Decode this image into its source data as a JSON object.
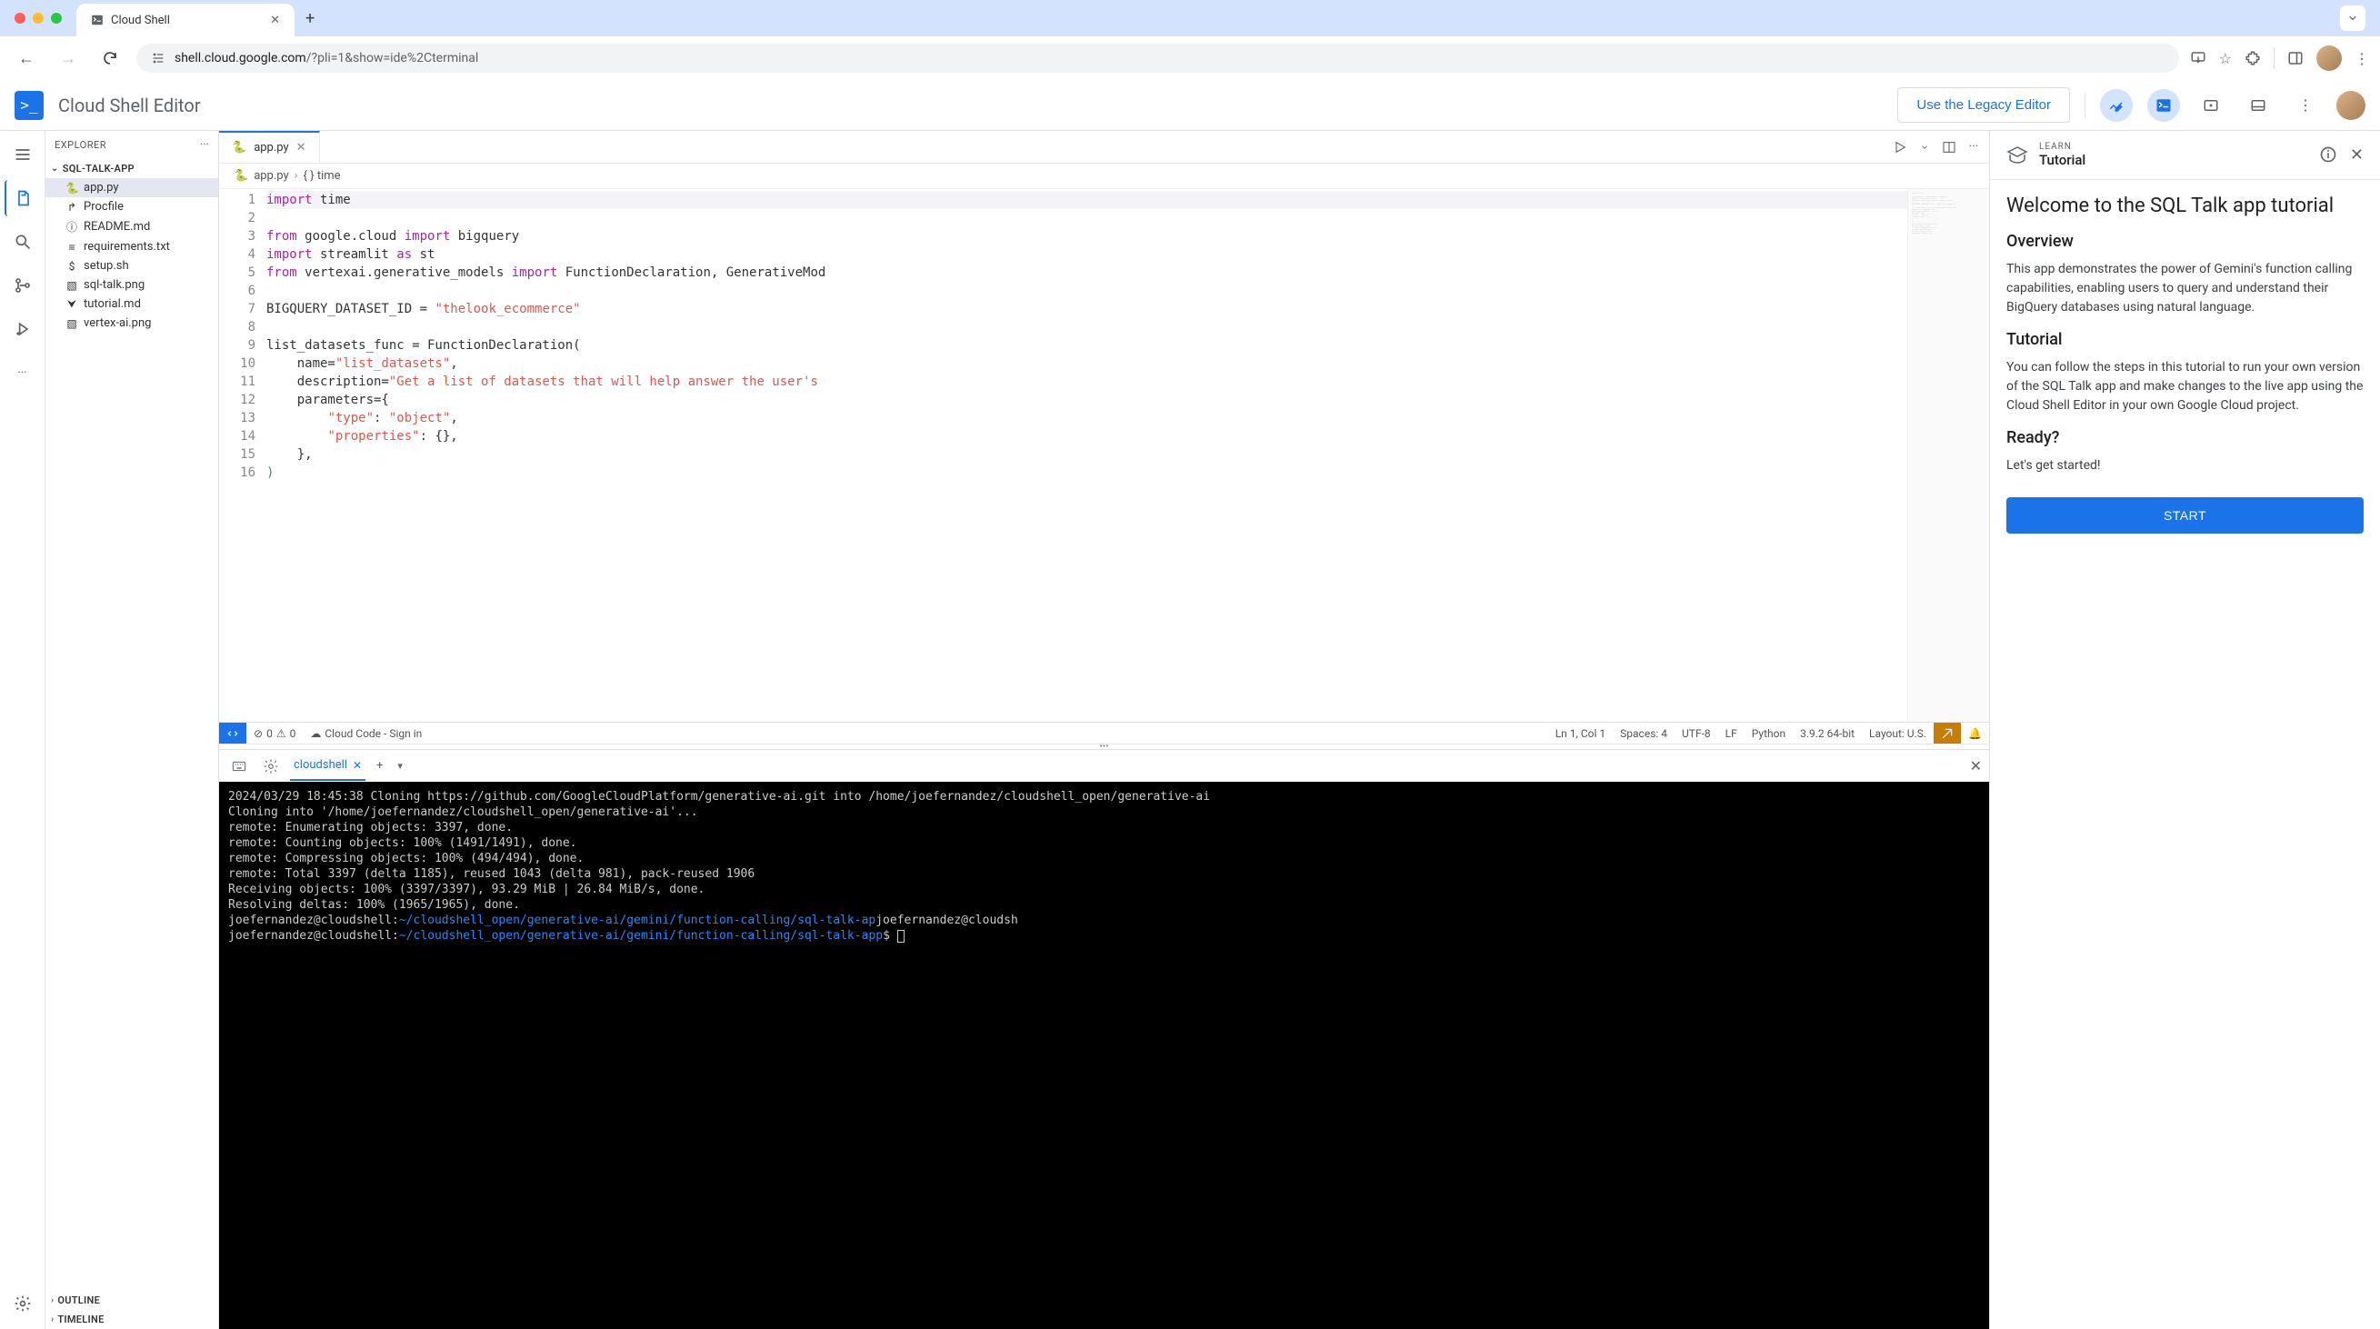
{
  "browser": {
    "tab_title": "Cloud Shell",
    "url_domain": "shell.cloud.google.com",
    "url_path": "/?pli=1&show=ide%2Cterminal"
  },
  "app_header": {
    "title": "Cloud Shell Editor",
    "legacy_button": "Use the Legacy Editor"
  },
  "explorer": {
    "title": "EXPLORER",
    "project_name": "SQL-TALK-APP",
    "outline": "OUTLINE",
    "timeline": "TIMELINE",
    "files": [
      {
        "name": "app.py",
        "icon": "🐍",
        "selected": true
      },
      {
        "name": "Procfile",
        "icon": "↱",
        "selected": false
      },
      {
        "name": "README.md",
        "icon": "ⓘ",
        "selected": false
      },
      {
        "name": "requirements.txt",
        "icon": "≡",
        "selected": false
      },
      {
        "name": "setup.sh",
        "icon": "$",
        "selected": false
      },
      {
        "name": "sql-talk.png",
        "icon": "▧",
        "selected": false
      },
      {
        "name": "tutorial.md",
        "icon": "⮟",
        "selected": false
      },
      {
        "name": "vertex-ai.png",
        "icon": "▧",
        "selected": false
      }
    ]
  },
  "editor": {
    "tab_name": "app.py",
    "breadcrumb_file": "app.py",
    "breadcrumb_symbol": "{ } time",
    "lines": [
      {
        "n": 1,
        "html": "<span class='kw'>import</span> time"
      },
      {
        "n": 2,
        "html": ""
      },
      {
        "n": 3,
        "html": "<span class='kw'>from</span> google.cloud <span class='kw'>import</span> bigquery"
      },
      {
        "n": 4,
        "html": "<span class='kw'>import</span> streamlit <span class='kw'>as</span> st"
      },
      {
        "n": 5,
        "html": "<span class='kw'>from</span> vertexai.generative_models <span class='kw'>import</span> FunctionDeclaration, GenerativeMod"
      },
      {
        "n": 6,
        "html": ""
      },
      {
        "n": 7,
        "html": "BIGQUERY_DATASET_ID = <span class='str2'>\"thelook_ecommerce\"</span>"
      },
      {
        "n": 8,
        "html": ""
      },
      {
        "n": 9,
        "html": "list_datasets_func = FunctionDeclaration("
      },
      {
        "n": 10,
        "html": "    name=<span class='str2'>\"list_datasets\"</span>,"
      },
      {
        "n": 11,
        "html": "    description=<span class='str2'>\"Get a list of datasets that will help answer the user's </span>"
      },
      {
        "n": 12,
        "html": "    parameters={"
      },
      {
        "n": 13,
        "html": "        <span class='str2'>\"type\"</span>: <span class='str2'>\"object\"</span>,"
      },
      {
        "n": 14,
        "html": "        <span class='str2'>\"properties\"</span>: {},"
      },
      {
        "n": 15,
        "html": "    },"
      },
      {
        "n": 16,
        "html": "<span class='fn'>)</span>"
      }
    ]
  },
  "status_bar": {
    "errors": "0",
    "warnings": "0",
    "cloud_code": "Cloud Code - Sign in",
    "cursor": "Ln 1, Col 1",
    "spaces": "Spaces: 4",
    "encoding": "UTF-8",
    "eol": "LF",
    "language": "Python",
    "python_version": "3.9.2 64-bit",
    "layout": "Layout: U.S."
  },
  "terminal": {
    "tab_name": "cloudshell",
    "lines": [
      "2024/03/29 18:45:38 Cloning https://github.com/GoogleCloudPlatform/generative-ai.git into /home/joefernandez/cloudshell_open/generative-ai",
      "Cloning into '/home/joefernandez/cloudshell_open/generative-ai'...",
      "remote: Enumerating objects: 3397, done.",
      "remote: Counting objects: 100% (1491/1491), done.",
      "remote: Compressing objects: 100% (494/494), done.",
      "remote: Total 3397 (delta 1185), reused 1043 (delta 981), pack-reused 1906",
      "Receiving objects: 100% (3397/3397), 93.29 MiB | 26.84 MiB/s, done.",
      "Resolving deltas: 100% (1965/1965), done."
    ],
    "prompt1_user": "joefernandez@cloudshell:",
    "prompt1_path": "~/cloudshell_open/generative-ai/gemini/function-calling/sql-talk-ap",
    "prompt1_trail": "joefernandez@cloudsh",
    "prompt2_user": "joefernandez@cloudshell:",
    "prompt2_path": "~/cloudshell_open/generative-ai/gemini/function-calling/sql-talk-app",
    "prompt2_dollar": "$ "
  },
  "tutorial": {
    "learn_label": "LEARN",
    "title_label": "Tutorial",
    "heading": "Welcome to the SQL Talk app tutorial",
    "overview_title": "Overview",
    "overview_body": "This app demonstrates the power of Gemini's function calling capabilities, enabling users to query and understand their BigQuery databases using natural language.",
    "tutorial_title": "Tutorial",
    "tutorial_body": "You can follow the steps in this tutorial to run your own version of the SQL Talk app and make changes to the live app using the Cloud Shell Editor in your own Google Cloud project.",
    "ready_title": "Ready?",
    "ready_body": "Let's get started!",
    "start_button": "START"
  }
}
